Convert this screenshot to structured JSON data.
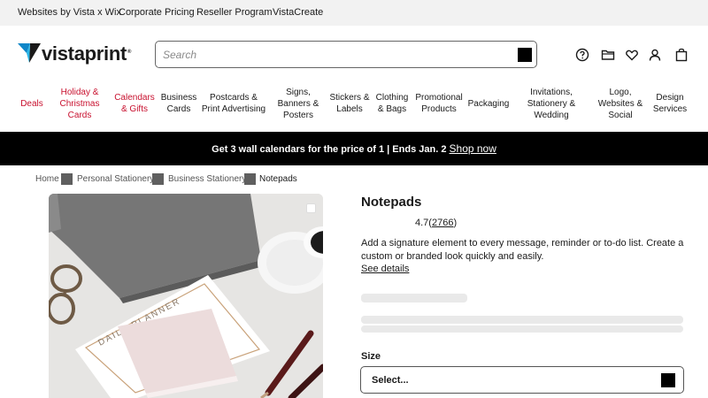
{
  "topbar": {
    "links": [
      "Websites by Vista x Wix",
      "Corporate Pricing",
      "Reseller Program",
      "VistaCreate"
    ]
  },
  "header": {
    "logo_text": "vistaprint",
    "search_placeholder": "Search",
    "icons": [
      "help-icon",
      "folder-icon",
      "heart-icon",
      "account-icon",
      "cart-icon"
    ]
  },
  "nav": {
    "items": [
      {
        "label": "Deals",
        "color": "#c8102e"
      },
      {
        "label": "Holiday & Christmas Cards",
        "color": "#c8102e"
      },
      {
        "label": "Calendars & Gifts",
        "color": "#c8102e"
      },
      {
        "label": "Business Cards"
      },
      {
        "label": "Postcards & Print Advertising"
      },
      {
        "label": "Signs, Banners & Posters"
      },
      {
        "label": "Stickers & Labels"
      },
      {
        "label": "Clothing & Bags"
      },
      {
        "label": "Promotional Products"
      },
      {
        "label": "Packaging"
      },
      {
        "label": "Invitations, Stationery & Wedding"
      },
      {
        "label": "Logo, Websites & Social"
      },
      {
        "label": "Design Services"
      }
    ]
  },
  "promo": {
    "text": "Get 3 wall calendars for the price of 1 | Ends Jan. 2",
    "link": "Shop now"
  },
  "breadcrumb": [
    "Home",
    "Personal Stationery",
    "Business Stationery",
    "Notepads"
  ],
  "product": {
    "title": "Notepads",
    "rating": "4.7",
    "review_count": "2766",
    "description": "Add a signature element to every message, reminder or to-do list. Create a custom or branded look quickly and easily.",
    "details_link": "See details",
    "size_label": "Size",
    "size_select_value": "Select...",
    "notepad_text": "DAILY PLANNER"
  }
}
